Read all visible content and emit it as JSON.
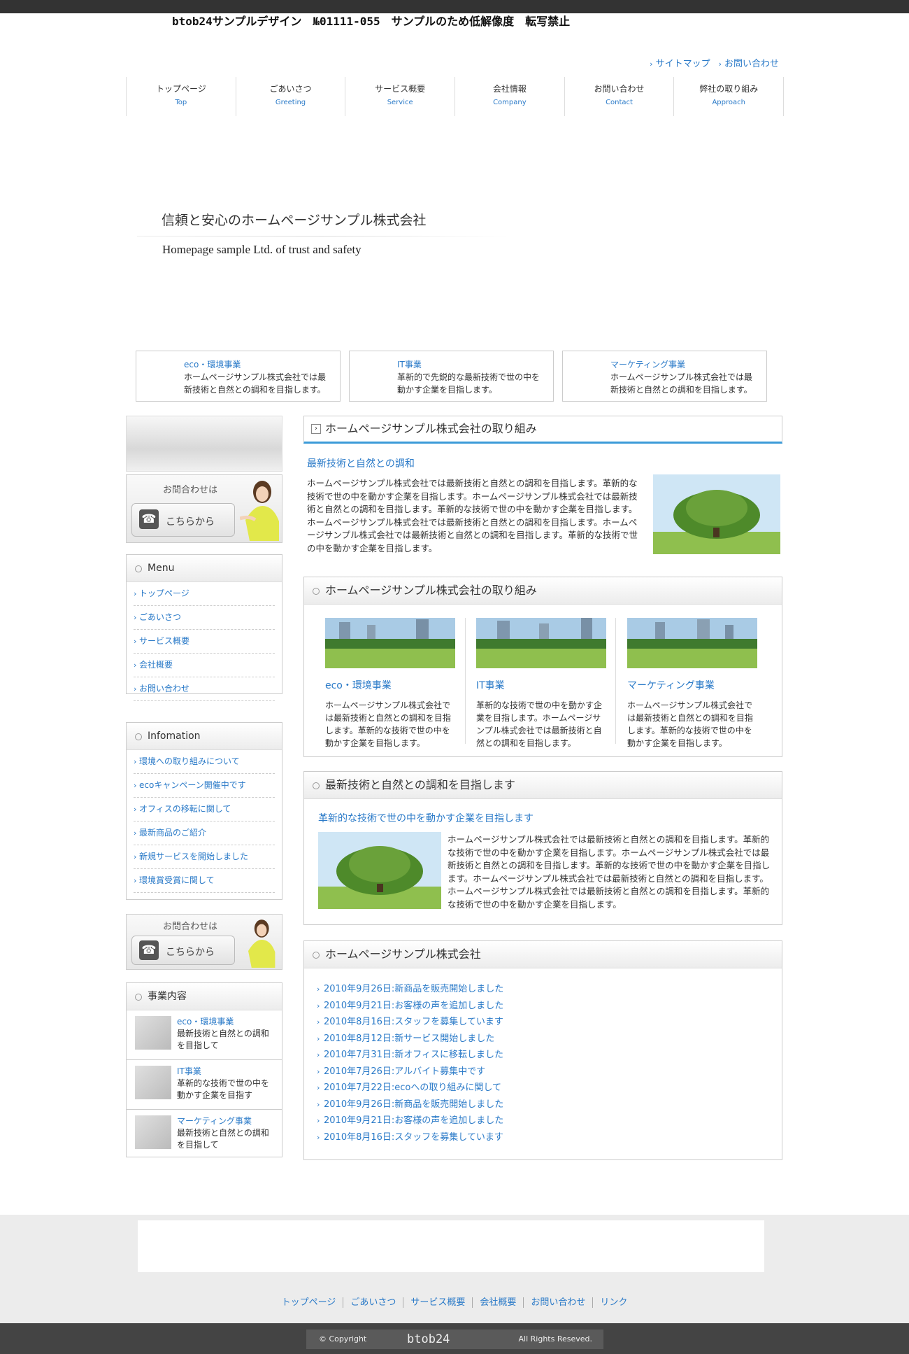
{
  "header": {
    "sample_note": "btob24サンプルデザイン　№01111-055　サンプルのため低解像度　転写禁止",
    "util_links": [
      "サイトマップ",
      "お問い合わせ"
    ]
  },
  "nav": [
    {
      "jp": "トップページ",
      "en": "Top"
    },
    {
      "jp": "ごあいさつ",
      "en": "Greeting"
    },
    {
      "jp": "サービス概要",
      "en": "Service"
    },
    {
      "jp": "会社情報",
      "en": "Company"
    },
    {
      "jp": "お問い合わせ",
      "en": "Contact"
    },
    {
      "jp": "弊社の取り組み",
      "en": "Approach"
    }
  ],
  "hero": {
    "title": "信頼と安心のホームページサンプル株式会社",
    "subtitle": "Homepage sample Ltd. of trust and safety"
  },
  "biz_boxes": [
    {
      "title": "eco・環境事業",
      "desc": "ホームページサンプル株式会社では最新技術と自然との調和を目指します。"
    },
    {
      "title": "IT事業",
      "desc": "革新的で先鋭的な最新技術で世の中を動かす企業を目指します。"
    },
    {
      "title": "マーケティング事業",
      "desc": "ホームページサンプル株式会社では最新技術と自然との調和を目指します。"
    }
  ],
  "sidebar": {
    "contact_caption": "お問合わせは",
    "contact_button": "こちらから",
    "menu_title": "Menu",
    "menu_items": [
      "トップページ",
      "ごあいさつ",
      "サービス概要",
      "会社概要",
      "お問い合わせ"
    ],
    "info_title": "Infomation",
    "info_items": [
      "環境への取り組みについて",
      "ecoキャンペーン開催中です",
      "オフィスの移転に関して",
      "最新商品のご紹介",
      "新規サービスを開始しました",
      "環境賞受賞に関して"
    ],
    "services_title": "事業内容",
    "services": [
      {
        "title": "eco・環境事業",
        "desc": "最新技術と自然との調和を目指して"
      },
      {
        "title": "IT事業",
        "desc": "革新的な技術で世の中を動かす企業を目指す"
      },
      {
        "title": "マーケティング事業",
        "desc": "最新技術と自然との調和を目指して"
      }
    ]
  },
  "main": {
    "section1_title": "ホームページサンプル株式会社の取り組み",
    "section1_sub": "最新技術と自然との調和",
    "section1_body": "ホームページサンプル株式会社では最新技術と自然との調和を目指します。革新的な技術で世の中を動かす企業を目指します。ホームページサンプル株式会社では最新技術と自然との調和を目指します。革新的な技術で世の中を動かす企業を目指します。ホームページサンプル株式会社では最新技術と自然との調和を目指します。ホームページサンプル株式会社では最新技術と自然との調和を目指します。革新的な技術で世の中を動かす企業を目指します。",
    "section2_title": "ホームページサンプル株式会社の取り組み",
    "section2_cols": [
      {
        "title": "eco・環境事業",
        "desc": "ホームページサンプル株式会社では最新技術と自然との調和を目指します。革新的な技術で世の中を動かす企業を目指します。"
      },
      {
        "title": "IT事業",
        "desc": "革新的な技術で世の中を動かす企業を目指します。ホームページサンプル株式会社では最新技術と自然との調和を目指します。"
      },
      {
        "title": "マーケティング事業",
        "desc": "ホームページサンプル株式会社では最新技術と自然との調和を目指します。革新的な技術で世の中を動かす企業を目指します。"
      }
    ],
    "section3_title": "最新技術と自然との調和を目指します",
    "section3_sub": "革新的な技術で世の中を動かす企業を目指します",
    "section3_body": "ホームページサンプル株式会社では最新技術と自然との調和を目指します。革新的な技術で世の中を動かす企業を目指します。ホームページサンプル株式会社では最新技術と自然との調和を目指します。革新的な技術で世の中を動かす企業を目指します。ホームページサンプル株式会社では最新技術と自然との調和を目指します。ホームページサンプル株式会社では最新技術と自然との調和を目指します。革新的な技術で世の中を動かす企業を目指します。",
    "section4_title": "ホームページサンプル株式会社",
    "news": [
      "2010年9月26日:新商品を販売開始しました",
      "2010年9月21日:お客様の声を追加しました",
      "2010年8月16日:スタッフを募集しています",
      "2010年8月12日:新サービス開始しました",
      "2010年7月31日:新オフィスに移転しました",
      "2010年7月26日:アルバイト募集中です",
      "2010年7月22日:ecoへの取り組みに関して",
      "2010年9月26日:新商品を販売開始しました",
      "2010年9月21日:お客様の声を追加しました",
      "2010年8月16日:スタッフを募集しています"
    ]
  },
  "footer": {
    "nav": [
      "トップページ",
      "ごあいさつ",
      "サービス概要",
      "会社概要",
      "お問い合わせ",
      "リンク"
    ],
    "copyright": "© Copyright",
    "brand": "btob24",
    "rights": "All Rights Reseved."
  },
  "colors": {
    "accent": "#2a7ac8",
    "header_rule": "#3b9bd8",
    "topbar": "#333333"
  }
}
